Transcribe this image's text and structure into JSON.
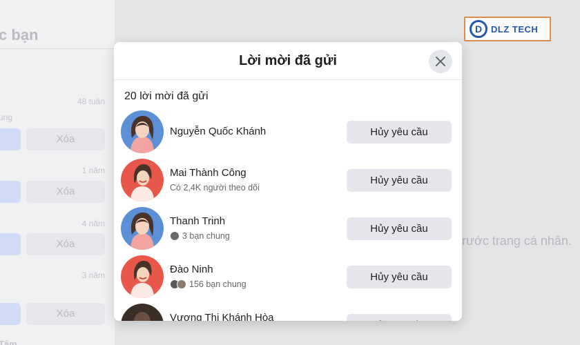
{
  "background": {
    "sidebar_title": "c bạn",
    "sub_label": "ung",
    "times": [
      "48 tuần",
      "1 năm",
      "4 năm",
      "3 năm"
    ],
    "delete_label": "Xóa",
    "bottom_label": "Tâm",
    "right_text": "trước trang cá nhân."
  },
  "logo": {
    "mark": "D",
    "text": "DLZ TECH"
  },
  "modal": {
    "title": "Lời mời đã gửi",
    "count_text": "20 lời mời đã gửi",
    "cancel_label": "Hủy yêu cầu",
    "close_icon": "close-icon",
    "rows": [
      {
        "name": "Nguyễn Quốc Khánh",
        "meta": "",
        "avatar": "avatar-blue"
      },
      {
        "name": "Mai Thành Công",
        "meta": "Có 2,4K người theo dõi",
        "avatar": "avatar-red"
      },
      {
        "name": "Thanh Trinh",
        "meta": "3 bạn chung",
        "avatar": "avatar-blue"
      },
      {
        "name": "Đào Ninh",
        "meta": "156 bạn chung",
        "avatar": "avatar-red"
      },
      {
        "name": "Vương Thị Khánh Hòa",
        "meta": "",
        "avatar": "avatar-photo"
      }
    ]
  },
  "colors": {
    "button_bg": "#e4e6eb",
    "avatar_blue": "#5b8fd6",
    "avatar_red": "#e8584a",
    "logo_blue": "#2457a8",
    "logo_border": "#e08a4a"
  }
}
